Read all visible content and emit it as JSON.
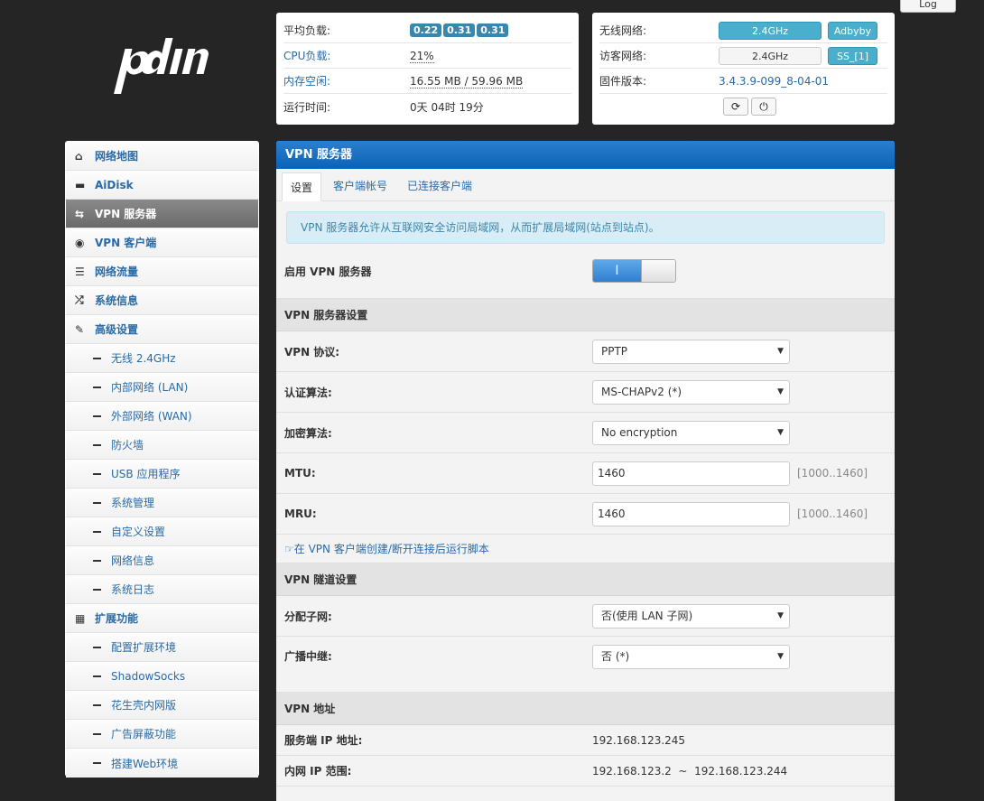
{
  "top": {
    "logout_label": "Log"
  },
  "status": {
    "load_label": "平均负载:",
    "load_values": [
      "0.22",
      "0.31",
      "0.31"
    ],
    "cpu_label": "CPU负载:",
    "cpu_value": "21%",
    "mem_label": "内存空闲:",
    "mem_value": "16.55 MB / 59.96 MB",
    "uptime_label": "运行时间:",
    "uptime_value": "0天 04时 19分"
  },
  "network": {
    "wireless_label": "无线网络:",
    "wireless_btn": "2.4GHz",
    "adbyby_btn": "Adbyby",
    "guest_label": "访客网络:",
    "guest_btn": "2.4GHz",
    "ss_btn": "SS_[1]",
    "firmware_label": "固件版本:",
    "firmware_value": "3.4.3.9-099_8-04-01"
  },
  "sidebar": {
    "items": [
      {
        "label": "网络地图",
        "icon": "home-icon",
        "glyph": "⌂"
      },
      {
        "label": "AiDisk",
        "icon": "hdd-icon",
        "glyph": "▬"
      },
      {
        "label": "VPN 服务器",
        "icon": "retweet-icon",
        "glyph": "⇆"
      },
      {
        "label": "VPN 客户端",
        "icon": "globe-icon",
        "glyph": "◉"
      },
      {
        "label": "网络流量",
        "icon": "list-icon",
        "glyph": "☰"
      },
      {
        "label": "系统信息",
        "icon": "shuffle-icon",
        "glyph": "⤮"
      },
      {
        "label": "高级设置",
        "icon": "wrench-icon",
        "glyph": "✎"
      }
    ],
    "advanced": [
      "无线 2.4GHz",
      "内部网络 (LAN)",
      "外部网络 (WAN)",
      "防火墙",
      "USB 应用程序",
      "系统管理",
      "自定义设置",
      "网络信息",
      "系统日志"
    ],
    "ext_label": "扩展功能",
    "ext_icon": "grid-icon",
    "ext_glyph": "▦",
    "ext": [
      "配置扩展环境",
      "ShadowSocks",
      "花生壳内网版",
      "广告屏蔽功能",
      "搭建Web环境"
    ]
  },
  "main": {
    "header": "VPN 服务器",
    "tabs": [
      "设置",
      "客户端帐号",
      "已连接客户端"
    ],
    "alert": "VPN 服务器允许从互联网安全访问局域网，从而扩展局域网(站点到站点)。",
    "enable_label": "启用 VPN 服务器",
    "toggle_on": "I",
    "section1": "VPN 服务器设置",
    "protocol_label": "VPN 协议:",
    "protocol_value": "PPTP",
    "auth_label": "认证算法:",
    "auth_value": "MS-CHAPv2 (*)",
    "enc_label": "加密算法:",
    "enc_value": "No encryption",
    "mtu_label": "MTU:",
    "mtu_value": "1460",
    "mtu_hint": "[1000..1460]",
    "mru_label": "MRU:",
    "mru_value": "1460",
    "mru_hint": "[1000..1460]",
    "script_link": "在 VPN 客户端创建/断开连接后运行脚本",
    "section2": "VPN 隧道设置",
    "subnet_label": "分配子网:",
    "subnet_value": "否(使用 LAN 子网)",
    "relay_label": "广播中继:",
    "relay_value": "否 (*)",
    "section3": "VPN 地址",
    "server_ip_label": "服务端 IP 地址:",
    "server_ip_value": "192.168.123.245",
    "range_label": "内网 IP 范围:",
    "range_value": "192.168.123.2  ~  192.168.123.244"
  }
}
